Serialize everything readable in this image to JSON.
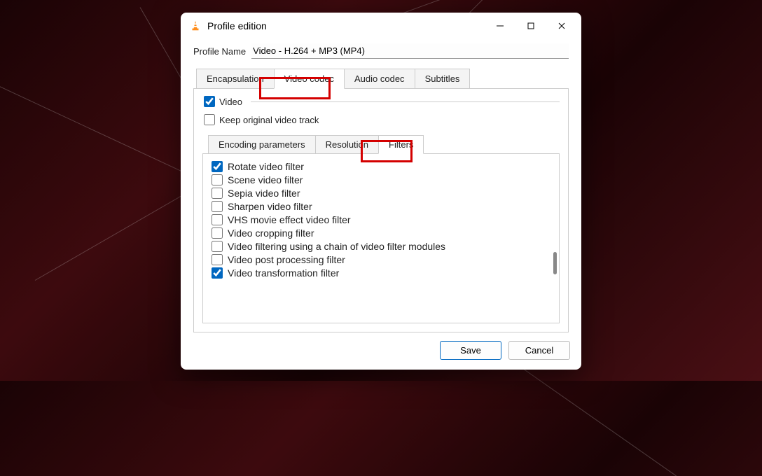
{
  "window": {
    "title": "Profile edition",
    "profile_name_label": "Profile Name",
    "profile_name_value": "Video - H.264 + MP3 (MP4)"
  },
  "tabs": {
    "encapsulation": "Encapsulation",
    "video_codec": "Video codec",
    "audio_codec": "Audio codec",
    "subtitles": "Subtitles",
    "active": "video_codec"
  },
  "video_panel": {
    "video_check": {
      "label": "Video",
      "checked": true
    },
    "keep_original": {
      "label": "Keep original video track",
      "checked": false
    }
  },
  "subtabs": {
    "encoding": "Encoding parameters",
    "resolution": "Resolution",
    "filters": "Filters",
    "active": "filters"
  },
  "filters": [
    {
      "label": "Rotate video filter",
      "checked": true
    },
    {
      "label": "Scene video filter",
      "checked": false
    },
    {
      "label": "Sepia video filter",
      "checked": false
    },
    {
      "label": "Sharpen video filter",
      "checked": false
    },
    {
      "label": "VHS movie effect video filter",
      "checked": false
    },
    {
      "label": "Video cropping filter",
      "checked": false
    },
    {
      "label": "Video filtering using a chain of video filter modules",
      "checked": false
    },
    {
      "label": "Video post processing filter",
      "checked": false
    },
    {
      "label": "Video transformation filter",
      "checked": true
    }
  ],
  "footer": {
    "save": "Save",
    "cancel": "Cancel"
  },
  "highlights": [
    "video_codec_tab",
    "filters_subtab"
  ]
}
